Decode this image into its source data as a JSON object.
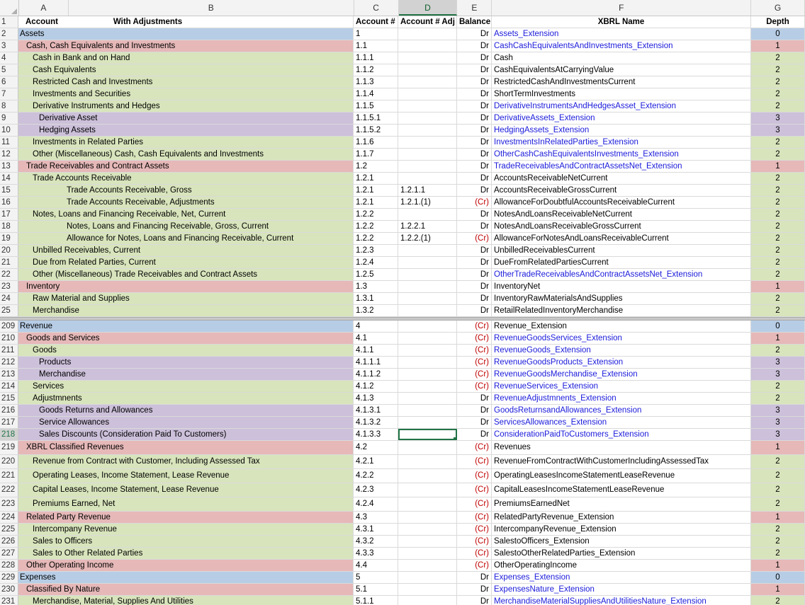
{
  "columns": [
    "A",
    "B",
    "C",
    "D",
    "E",
    "F",
    "G"
  ],
  "selected_column": "D",
  "selected_row": "218",
  "header_row": {
    "rn": "1",
    "a": "Account",
    "b": "With Adjustments",
    "c": "Account #",
    "d": "Account # Adj",
    "e": "Balance",
    "f": "XBRL Name",
    "g": "Depth"
  },
  "rows_top": [
    {
      "rn": "2",
      "label": "Assets",
      "indent": 0,
      "c": "1",
      "d": "",
      "e": "Dr",
      "f": "Assets_Extension",
      "link": true,
      "g": "0",
      "color": "blue"
    },
    {
      "rn": "3",
      "label": "Cash, Cash Equivalents and Investments",
      "indent": 1,
      "c": "1.1",
      "d": "",
      "e": "Dr",
      "f": "CashCashEquivalentsAndInvestments_Extension",
      "link": true,
      "g": "1",
      "color": "red"
    },
    {
      "rn": "4",
      "label": "Cash in Bank and on Hand",
      "indent": 2,
      "c": "1.1.1",
      "d": "",
      "e": "Dr",
      "f": "Cash",
      "link": false,
      "g": "2",
      "color": "green"
    },
    {
      "rn": "5",
      "label": "Cash Equivalents",
      "indent": 2,
      "c": "1.1.2",
      "d": "",
      "e": "Dr",
      "f": "CashEquivalentsAtCarryingValue",
      "link": false,
      "g": "2",
      "color": "green"
    },
    {
      "rn": "6",
      "label": "Restricted Cash and Investments",
      "indent": 2,
      "c": "1.1.3",
      "d": "",
      "e": "Dr",
      "f": "RestrictedCashAndInvestmentsCurrent",
      "link": false,
      "g": "2",
      "color": "green"
    },
    {
      "rn": "7",
      "label": "Investments and Securities",
      "indent": 2,
      "c": "1.1.4",
      "d": "",
      "e": "Dr",
      "f": "ShortTermInvestments",
      "link": false,
      "g": "2",
      "color": "green"
    },
    {
      "rn": "8",
      "label": "Derivative Instruments and Hedges",
      "indent": 2,
      "c": "1.1.5",
      "d": "",
      "e": "Dr",
      "f": "DerivativeInstrumentsAndHedgesAsset_Extension",
      "link": true,
      "g": "2",
      "color": "green"
    },
    {
      "rn": "9",
      "label": "Derivative Asset",
      "indent": 3,
      "c": "1.1.5.1",
      "d": "",
      "e": "Dr",
      "f": "DerivativeAssets_Extension",
      "link": true,
      "g": "3",
      "color": "purple"
    },
    {
      "rn": "10",
      "label": "Hedging Assets",
      "indent": 3,
      "c": "1.1.5.2",
      "d": "",
      "e": "Dr",
      "f": "HedgingAssets_Extension",
      "link": true,
      "g": "3",
      "color": "purple"
    },
    {
      "rn": "11",
      "label": "Investments in Related Parties",
      "indent": 2,
      "c": "1.1.6",
      "d": "",
      "e": "Dr",
      "f": "InvestmentsInRelatedParties_Extension",
      "link": true,
      "g": "2",
      "color": "green"
    },
    {
      "rn": "12",
      "label": "Other (Miscellaneous) Cash, Cash Equivalents and Investments",
      "indent": 2,
      "c": "1.1.7",
      "d": "",
      "e": "Dr",
      "f": "OtherCashCashEquivalentsInvestments_Extension",
      "link": true,
      "g": "2",
      "color": "green"
    },
    {
      "rn": "13",
      "label": "Trade Receivables and Contract Assets",
      "indent": 1,
      "c": "1.2",
      "d": "",
      "e": "Dr",
      "f": "TradeReceivablesAndContractAssetsNet_Extension",
      "link": true,
      "g": "1",
      "color": "red"
    },
    {
      "rn": "14",
      "label": "Trade Accounts Receivable",
      "indent": 2,
      "c": "1.2.1",
      "d": "",
      "e": "Dr",
      "f": "AccountsReceivableNetCurrent",
      "link": false,
      "g": "2",
      "color": "green"
    },
    {
      "rn": "15",
      "label": "Trade Accounts Receivable, Gross",
      "indent": 4,
      "c": "1.2.1",
      "d": "1.2.1.1",
      "e": "Dr",
      "f": "AccountsReceivableGrossCurrent",
      "link": false,
      "g": "2",
      "color": "green"
    },
    {
      "rn": "16",
      "label": "Trade Accounts Receivable, Adjustments",
      "indent": 4,
      "c": "1.2.1",
      "d": "1.2.1.(1)",
      "e": "(Cr)",
      "f": "AllowanceForDoubtfulAccountsReceivableCurrent",
      "link": false,
      "g": "2",
      "color": "green"
    },
    {
      "rn": "17",
      "label": "Notes, Loans and Financing Receivable, Net, Current",
      "indent": 2,
      "c": "1.2.2",
      "d": "",
      "e": "Dr",
      "f": "NotesAndLoansReceivableNetCurrent",
      "link": false,
      "g": "2",
      "color": "green"
    },
    {
      "rn": "18",
      "label": "Notes, Loans and Financing Receivable, Gross, Current",
      "indent": 4,
      "c": "1.2.2",
      "d": "1.2.2.1",
      "e": "Dr",
      "f": "NotesAndLoansReceivableGrossCurrent",
      "link": false,
      "g": "2",
      "color": "green"
    },
    {
      "rn": "19",
      "label": "Allowance for Notes, Loans and Financing Receivable, Current",
      "indent": 4,
      "c": "1.2.2",
      "d": "1.2.2.(1)",
      "e": "(Cr)",
      "f": "AllowanceForNotesAndLoansReceivableCurrent",
      "link": false,
      "g": "2",
      "color": "green"
    },
    {
      "rn": "20",
      "label": "Unbilled Receivables, Current",
      "indent": 2,
      "c": "1.2.3",
      "d": "",
      "e": "Dr",
      "f": "UnbilledReceivablesCurrent",
      "link": false,
      "g": "2",
      "color": "green"
    },
    {
      "rn": "21",
      "label": "Due from Related Parties, Current",
      "indent": 2,
      "c": "1.2.4",
      "d": "",
      "e": "Dr",
      "f": "DueFromRelatedPartiesCurrent",
      "link": false,
      "g": "2",
      "color": "green"
    },
    {
      "rn": "22",
      "label": "Other (Miscellaneous) Trade Receivables and Contract Assets",
      "indent": 2,
      "c": "1.2.5",
      "d": "",
      "e": "Dr",
      "f": "OtherTradeReceivablesAndContractAssetsNet_Extension",
      "link": true,
      "g": "2",
      "color": "green"
    },
    {
      "rn": "23",
      "label": "Inventory",
      "indent": 1,
      "c": "1.3",
      "d": "",
      "e": "Dr",
      "f": "InventoryNet",
      "link": false,
      "g": "1",
      "color": "red"
    },
    {
      "rn": "24",
      "label": "Raw Material and Supplies",
      "indent": 2,
      "c": "1.3.1",
      "d": "",
      "e": "Dr",
      "f": "InventoryRawMaterialsAndSupplies",
      "link": false,
      "g": "2",
      "color": "green"
    },
    {
      "rn": "25",
      "label": "Merchandise",
      "indent": 2,
      "c": "1.3.2",
      "d": "",
      "e": "Dr",
      "f": "RetailRelatedInventoryMerchandise",
      "link": false,
      "g": "2",
      "color": "green"
    }
  ],
  "rows_bottom": [
    {
      "rn": "209",
      "label": "Revenue",
      "indent": 0,
      "c": "4",
      "d": "",
      "e": "(Cr)",
      "f": "Revenue_Extension",
      "link": false,
      "g": "0",
      "color": "blue"
    },
    {
      "rn": "210",
      "label": "Goods and Services",
      "indent": 1,
      "c": "4.1",
      "d": "",
      "e": "(Cr)",
      "f": "RevenueGoodsServices_Extension",
      "link": true,
      "g": "1",
      "color": "red"
    },
    {
      "rn": "211",
      "label": "Goods",
      "indent": 2,
      "c": "4.1.1",
      "d": "",
      "e": "(Cr)",
      "f": "RevenueGoods_Extension",
      "link": true,
      "g": "2",
      "color": "green"
    },
    {
      "rn": "212",
      "label": "Products",
      "indent": 3,
      "c": "4.1.1.1",
      "d": "",
      "e": "(Cr)",
      "f": "RevenueGoodsProducts_Extension",
      "link": true,
      "g": "3",
      "color": "purple"
    },
    {
      "rn": "213",
      "label": "Merchandise",
      "indent": 3,
      "c": "4.1.1.2",
      "d": "",
      "e": "(Cr)",
      "f": "RevenueGoodsMerchandise_Extension",
      "link": true,
      "g": "3",
      "color": "purple"
    },
    {
      "rn": "214",
      "label": "Services",
      "indent": 2,
      "c": "4.1.2",
      "d": "",
      "e": "(Cr)",
      "f": "RevenueServices_Extension",
      "link": true,
      "g": "2",
      "color": "green"
    },
    {
      "rn": "215",
      "label": "Adjustmnents",
      "indent": 2,
      "c": "4.1.3",
      "d": "",
      "e": "Dr",
      "f": "RevenueAdjustmnents_Extension",
      "link": true,
      "g": "2",
      "color": "green"
    },
    {
      "rn": "216",
      "label": "Goods Returns and Allowances",
      "indent": 3,
      "c": "4.1.3.1",
      "d": "",
      "e": "Dr",
      "f": "GoodsReturnsandAllowances_Extension",
      "link": true,
      "g": "3",
      "color": "purple"
    },
    {
      "rn": "217",
      "label": "Service Allowances",
      "indent": 3,
      "c": "4.1.3.2",
      "d": "",
      "e": "Dr",
      "f": "ServicesAllowances_Extension",
      "link": true,
      "g": "3",
      "color": "purple"
    },
    {
      "rn": "218",
      "label": "Sales Discounts (Consideration Paid To Customers)",
      "indent": 3,
      "c": "4.1.3.3",
      "d": "",
      "e": "Dr",
      "f": "ConsiderationPaidToCustomers_Extension",
      "link": true,
      "g": "3",
      "color": "purple",
      "selected": true
    },
    {
      "rn": "219",
      "label": "XBRL Classified Revenues",
      "indent": 1,
      "c": "4.2",
      "d": "",
      "e": "(Cr)",
      "f": "Revenues",
      "link": false,
      "g": "1",
      "color": "red",
      "tall": true
    },
    {
      "rn": "220",
      "label": "Revenue from Contract with Customer, Including Assessed Tax",
      "indent": 2,
      "c": "4.2.1",
      "d": "",
      "e": "(Cr)",
      "f": "RevenueFromContractWithCustomerIncludingAssessedTax",
      "link": false,
      "g": "2",
      "color": "green",
      "tall": true
    },
    {
      "rn": "221",
      "label": "Operating Leases, Income Statement, Lease Revenue",
      "indent": 2,
      "c": "4.2.2",
      "d": "",
      "e": "(Cr)",
      "f": "OperatingLeasesIncomeStatementLeaseRevenue",
      "link": false,
      "g": "2",
      "color": "green",
      "tall": true
    },
    {
      "rn": "222",
      "label": "Capital Leases, Income Statement, Lease Revenue",
      "indent": 2,
      "c": "4.2.3",
      "d": "",
      "e": "(Cr)",
      "f": "CapitalLeasesIncomeStatementLeaseRevenue",
      "link": false,
      "g": "2",
      "color": "green",
      "tall": true
    },
    {
      "rn": "223",
      "label": "Premiums Earned, Net",
      "indent": 2,
      "c": "4.2.4",
      "d": "",
      "e": "(Cr)",
      "f": "PremiumsEarnedNet",
      "link": false,
      "g": "2",
      "color": "green",
      "tall": true
    },
    {
      "rn": "224",
      "label": "Related Party Revenue",
      "indent": 1,
      "c": "4.3",
      "d": "",
      "e": "(Cr)",
      "f": "RelatedPartyRevenue_Extension",
      "link": false,
      "g": "1",
      "color": "red"
    },
    {
      "rn": "225",
      "label": "Intercompany Revenue",
      "indent": 2,
      "c": "4.3.1",
      "d": "",
      "e": "(Cr)",
      "f": "IntercompanyRevenue_Extension",
      "link": false,
      "g": "2",
      "color": "green"
    },
    {
      "rn": "226",
      "label": "Sales to Officers",
      "indent": 2,
      "c": "4.3.2",
      "d": "",
      "e": "(Cr)",
      "f": "SalestoOfficers_Extension",
      "link": false,
      "g": "2",
      "color": "green"
    },
    {
      "rn": "227",
      "label": "Sales to Other Related Parties",
      "indent": 2,
      "c": "4.3.3",
      "d": "",
      "e": "(Cr)",
      "f": "SalestoOtherRelatedParties_Extension",
      "link": false,
      "g": "2",
      "color": "green"
    },
    {
      "rn": "228",
      "label": "Other Operating Income",
      "indent": 1,
      "c": "4.4",
      "d": "",
      "e": "(Cr)",
      "f": "OtherOperatingIncome",
      "link": false,
      "g": "1",
      "color": "red"
    },
    {
      "rn": "229",
      "label": "Expenses",
      "indent": 0,
      "c": "5",
      "d": "",
      "e": "Dr",
      "f": "Expenses_Extension",
      "link": true,
      "g": "0",
      "color": "blue"
    },
    {
      "rn": "230",
      "label": "Classified By Nature",
      "indent": 1,
      "c": "5.1",
      "d": "",
      "e": "Dr",
      "f": "ExpensesNature_Extension",
      "link": true,
      "g": "1",
      "color": "red"
    },
    {
      "rn": "231",
      "label": "Merchandise, Material, Supplies And Utilities",
      "indent": 2,
      "c": "5.1.1",
      "d": "",
      "e": "Dr",
      "f": "MerchandiseMaterialSuppliesAndUtilitiesNature_Extension",
      "link": true,
      "g": "2",
      "color": "green"
    }
  ]
}
